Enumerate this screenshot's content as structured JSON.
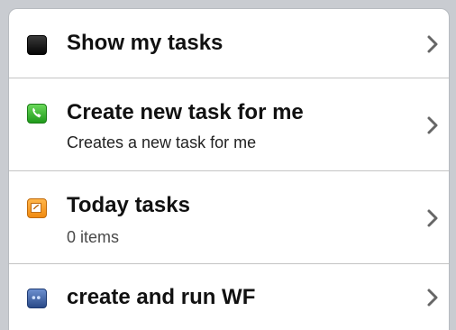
{
  "menu": {
    "items": [
      {
        "title": "Show my tasks",
        "subtitle": "",
        "icon": "tasks-icon",
        "icon_color": "#111111"
      },
      {
        "title": "Create new task for me",
        "subtitle": "Creates a new task for me",
        "icon": "phone-icon",
        "icon_color": "#2fb32a"
      },
      {
        "title": "Today tasks",
        "subtitle": "0 items",
        "icon": "calendar-icon",
        "icon_color": "#f39a1e"
      },
      {
        "title": "create and run WF",
        "subtitle": "",
        "icon": "workflow-icon",
        "icon_color": "#3a5fa8"
      }
    ]
  },
  "colors": {
    "separator": "#c4c4c4",
    "chevron": "#666666",
    "frame": "#c9ccd1"
  }
}
